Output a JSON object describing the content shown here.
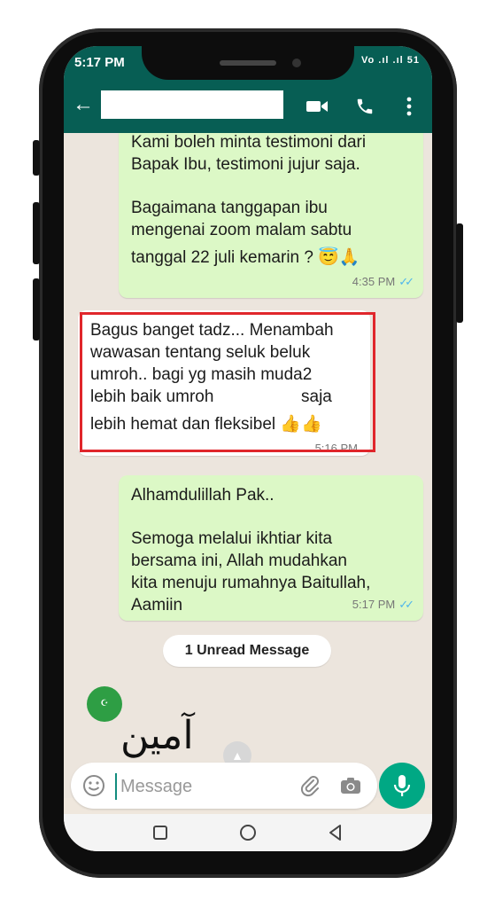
{
  "status_bar": {
    "time": "5:17 PM",
    "indicators": "Vo .ıl .ıl 51"
  },
  "app_bar": {
    "back_icon": "arrow-left-icon",
    "video_icon": "video-camera-icon",
    "call_icon": "phone-icon",
    "menu_icon": "more-vertical-icon"
  },
  "messages": [
    {
      "direction": "outgoing",
      "lines": [
        "Kami boleh minta testimoni dari",
        "Bapak Ibu, testimoni jujur saja.",
        "",
        "Bagaimana tanggapan ibu",
        "mengenai zoom malam sabtu",
        "tanggal 22 juli kemarin ? 😇🙏"
      ],
      "time": "4:35 PM",
      "read": true
    },
    {
      "direction": "incoming",
      "lines": [
        "Bagus banget tadz... Menambah",
        "wawasan tentang seluk beluk",
        "umroh.. bagi yg masih muda2",
        "lebih baik umroh",
        "saja",
        "lebih hemat dan fleksibel 👍👍"
      ],
      "time": "5:16 PM",
      "highlighted": true
    },
    {
      "direction": "outgoing",
      "lines": [
        "Alhamdulillah Pak..",
        "",
        "Semoga melalui ikhtiar kita",
        "bersama ini, Allah mudahkan",
        "kita menuju rumahnya Baitullah,",
        "Aamiin"
      ],
      "time": "5:17 PM",
      "read": true
    }
  ],
  "unread_label": "1 Unread Message",
  "input": {
    "placeholder": "Message",
    "value": ""
  },
  "colors": {
    "header": "#075e54",
    "outgoing_bubble": "#dcf8c6",
    "incoming_bubble": "#ffffff",
    "highlight": "#e0262b",
    "mic": "#00a884"
  }
}
